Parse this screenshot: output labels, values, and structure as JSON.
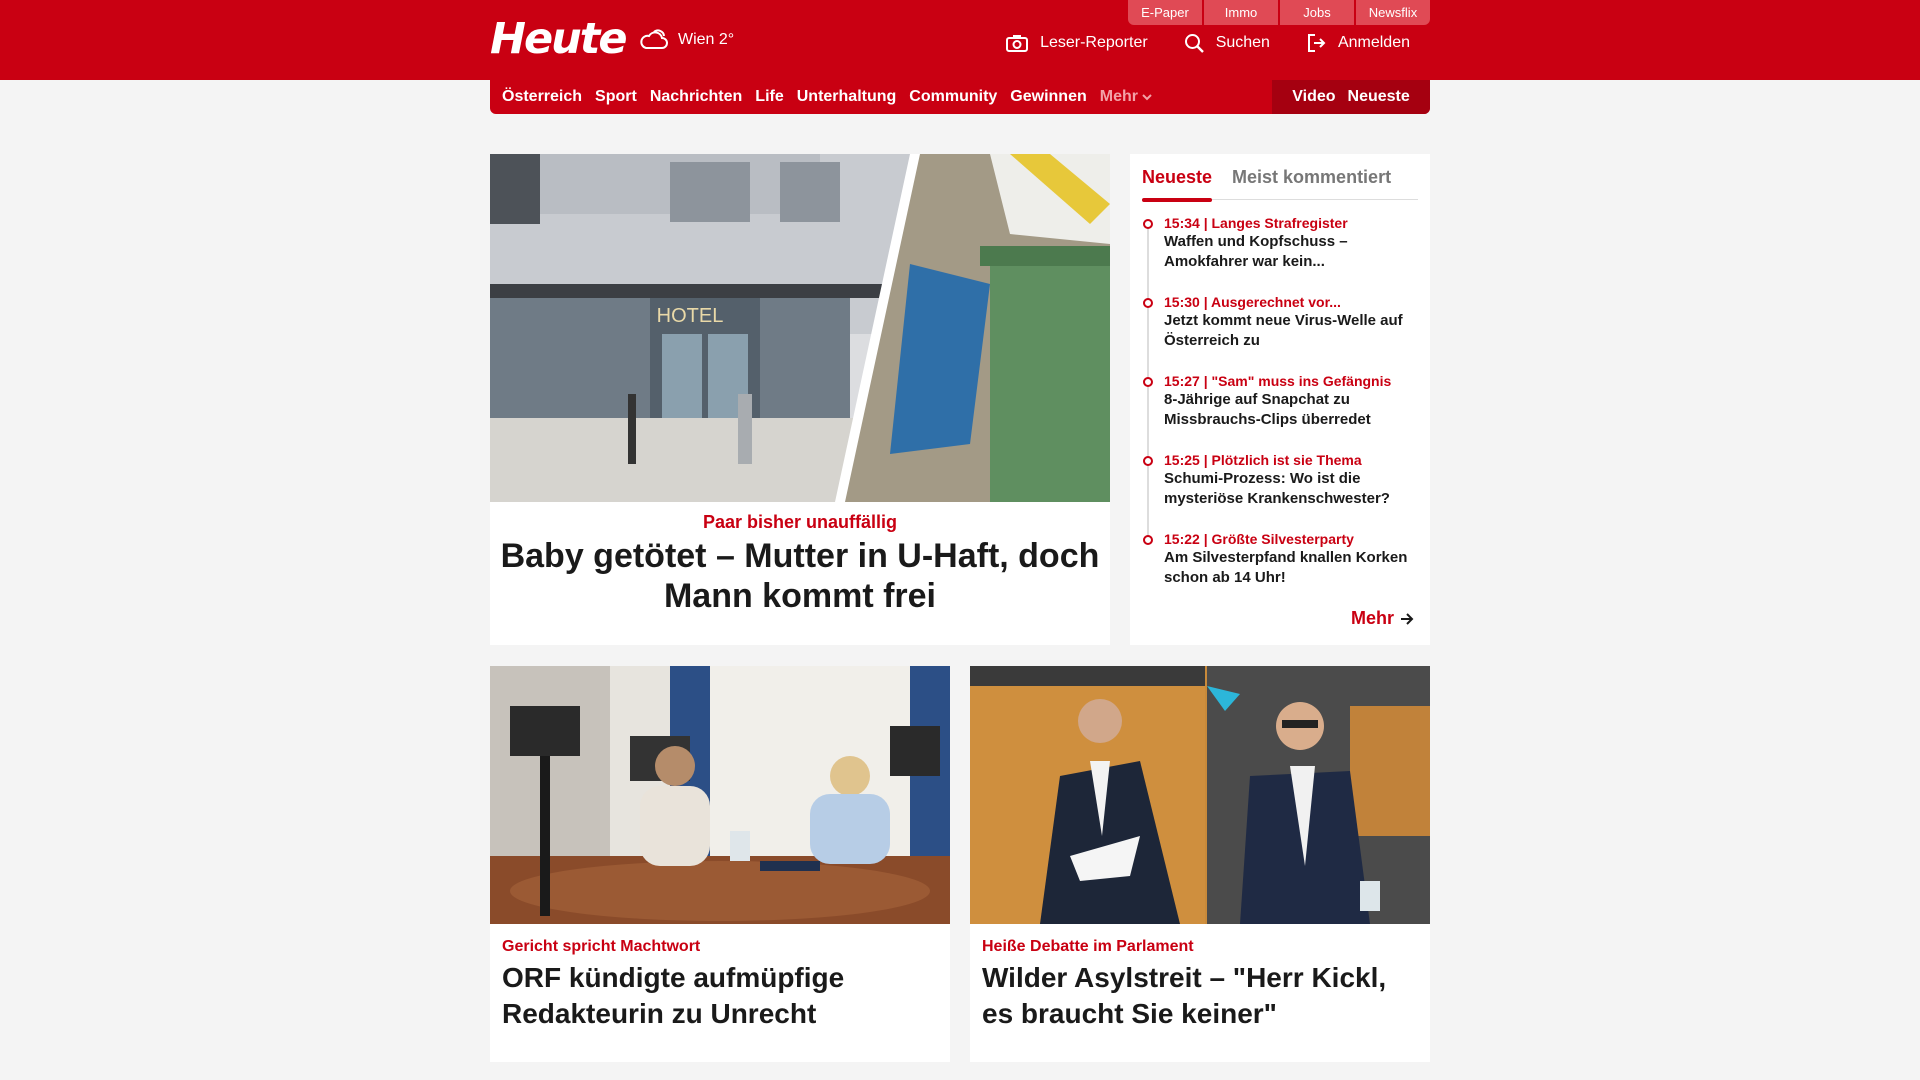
{
  "header": {
    "logo": "Heute",
    "weather": "Wien 2°",
    "top_links": [
      "E-Paper",
      "Immo",
      "Jobs",
      "Newsflix"
    ],
    "tools": {
      "reporter": "Leser-Reporter",
      "search": "Suchen",
      "login": "Anmelden"
    }
  },
  "nav": {
    "items": [
      "Österreich",
      "Sport",
      "Nachrichten",
      "Life",
      "Unterhaltung",
      "Community",
      "Gewinnen"
    ],
    "more": "Mehr",
    "video": "Video",
    "latest": "Neueste"
  },
  "hero": {
    "kicker": "Paar bisher unauffällig",
    "title": "Baby getötet – Mutter in U-Haft, doch Mann kommt frei",
    "image_text": "HOTEL"
  },
  "sidebar": {
    "tabs": [
      "Neueste",
      "Meist kommentiert"
    ],
    "items": [
      {
        "meta": "15:34 | Langes Strafregister",
        "text": "Waffen und Kopfschuss – Amokfahrer war kein..."
      },
      {
        "meta": "15:30 | Ausgerechnet vor...",
        "text": "Jetzt kommt neue Virus-Welle auf Österreich zu"
      },
      {
        "meta": "15:27 | \"Sam\" muss ins Gefängnis",
        "text": "8-Jährige auf Snapchat zu Missbrauchs-Clips überredet"
      },
      {
        "meta": "15:25 | Plötzlich ist sie Thema",
        "text": "Schumi-Prozess: Wo ist die mysteriöse Krankenschwester?"
      },
      {
        "meta": "15:22 | Größte Silvesterparty",
        "text": "Am Silvesterpfand knallen Korken schon ab 14 Uhr!"
      }
    ],
    "more": "Mehr"
  },
  "cards": [
    {
      "kicker": "Gericht spricht Machtwort",
      "title": "ORF kündigte aufmüpfige Redakteurin zu Unrecht"
    },
    {
      "kicker": "Heiße Debatte im Parlament",
      "title": "Wilder Asylstreit – \"Herr Kickl, es braucht Sie keiner\""
    }
  ],
  "colors": {
    "brand": "#c90012",
    "background": "#f4f4f4"
  }
}
